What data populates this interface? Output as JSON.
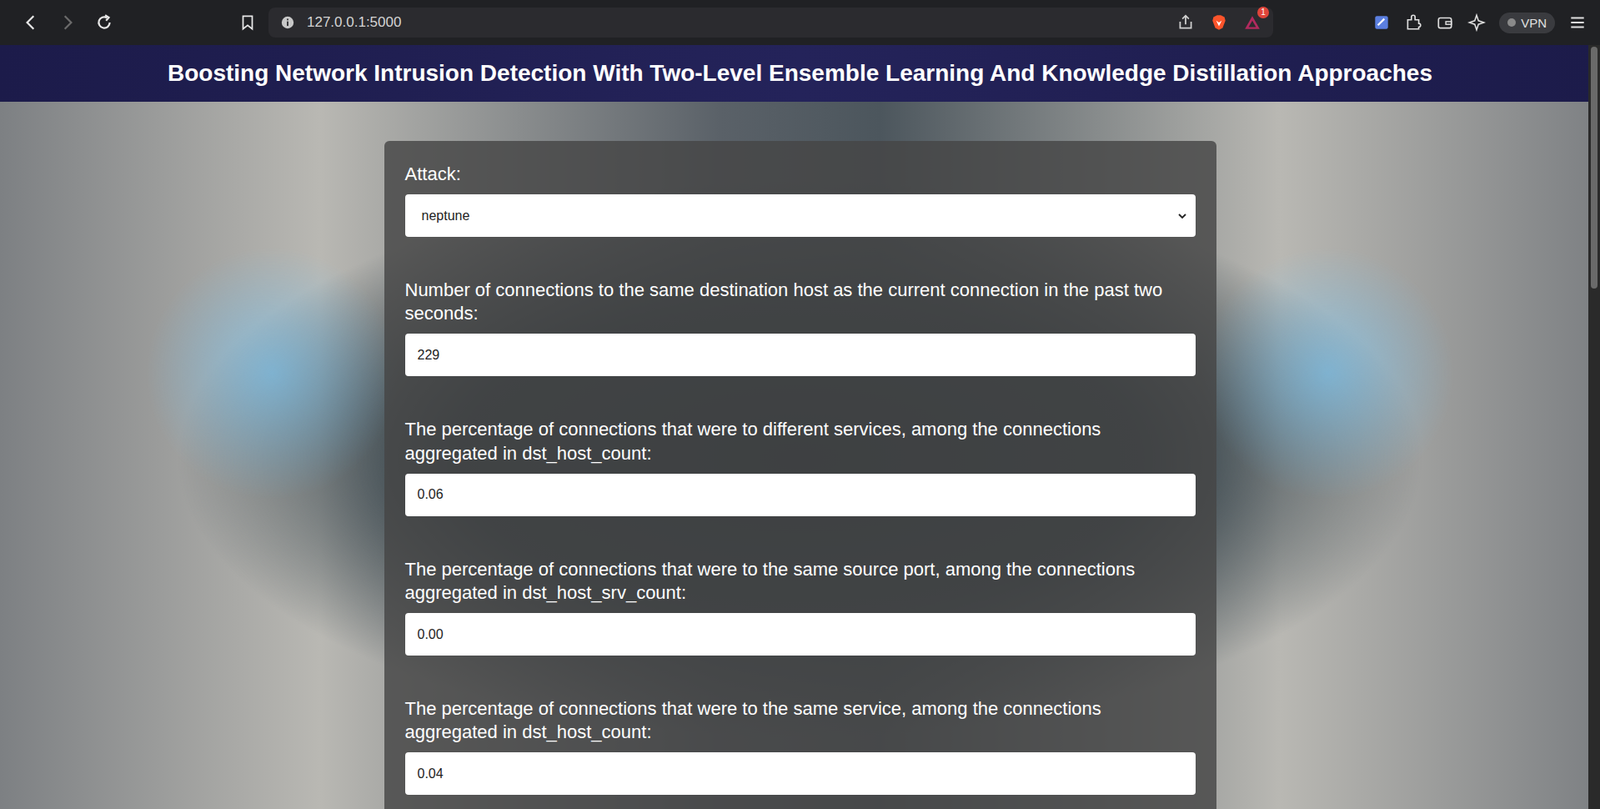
{
  "browser": {
    "address": "127.0.0.1:5000",
    "badge": "1",
    "vpn": "VPN"
  },
  "header": {
    "title": "Boosting Network Intrusion Detection With Two-Level Ensemble Learning And Knowledge Distillation Approaches"
  },
  "form": {
    "fields": [
      {
        "kind": "select",
        "label": "Attack:",
        "value": "neptune"
      },
      {
        "kind": "input",
        "label": "Number of connections to the same destination host as the current connection in the past two seconds:",
        "value": "229"
      },
      {
        "kind": "input",
        "label": "The percentage of connections that were to different services, among the connections aggregated in dst_host_count:",
        "value": "0.06"
      },
      {
        "kind": "input",
        "label": "The percentage of connections that were to the same source port, among the connections aggregated in dst_host_srv_count:",
        "value": "0.00"
      },
      {
        "kind": "input",
        "label": "The percentage of connections that were to the same service, among the connections aggregated in dst_host_count:",
        "value": "0.04"
      }
    ]
  }
}
